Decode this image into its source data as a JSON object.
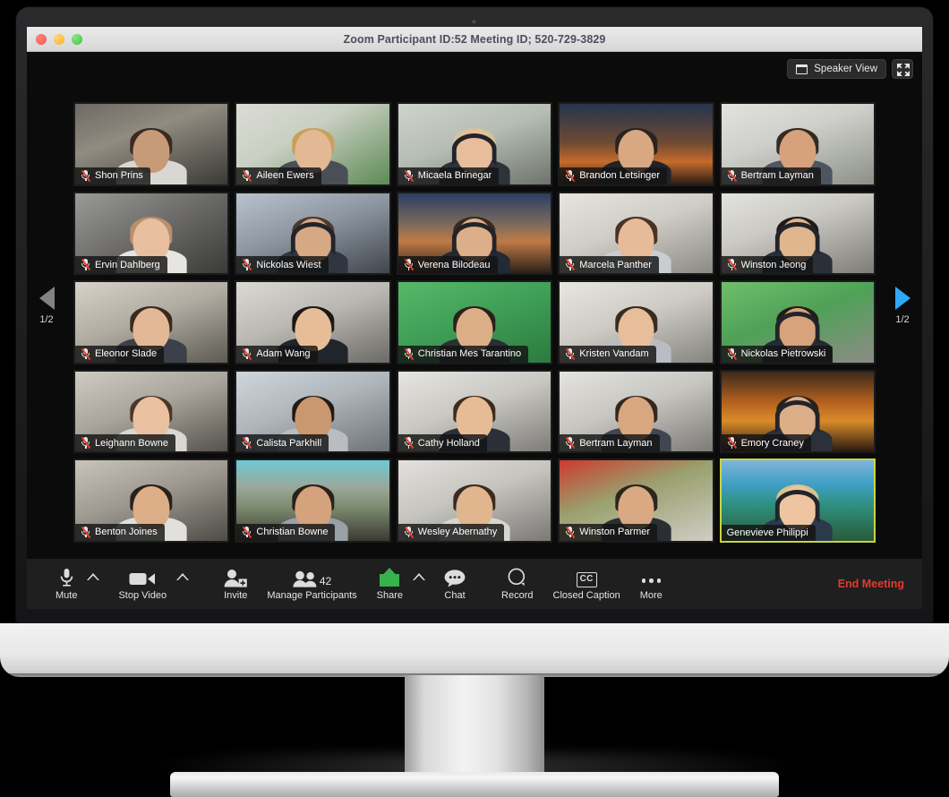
{
  "window": {
    "title": "Zoom Participant ID:52  Meeting ID; 520-729-3829",
    "traffic_lights": [
      "close-red",
      "minimize-yellow",
      "zoom-green"
    ]
  },
  "view_controls": {
    "speaker_view_label": "Speaker View",
    "screen_icon": "screen-icon",
    "fullscreen_icon": "fullscreen-icon"
  },
  "pager": {
    "left_label": "1/2",
    "right_label": "1/2",
    "left_icon": "triangle-left-icon",
    "right_icon": "triangle-right-icon",
    "left_color": "#828284",
    "right_color": "#2fa8f5"
  },
  "gallery": {
    "active_border_color": "#c7d63f",
    "rows": 5,
    "cols": 5,
    "tiles": [
      {
        "name": "Shon Prins",
        "muted": true,
        "active": false,
        "bg": "linear-gradient(160deg,#6d6a64 0%,#918b80 38%,#3b3a38 100%)",
        "skin": "#c79a78",
        "hair": "#3b2a20",
        "shirt": "#d8d7d3",
        "headphones": false
      },
      {
        "name": "Aileen Ewers",
        "muted": true,
        "active": false,
        "bg": "linear-gradient(150deg,#dcdcd6 0%,#c9cfc2 40%,#5d8a55 100%)",
        "skin": "#e3b894",
        "hair": "#c9a05a",
        "shirt": "#4a4f57",
        "headphones": false
      },
      {
        "name": "Micaela Brinegar",
        "muted": true,
        "active": false,
        "bg": "linear-gradient(160deg,#cfd3cd 0%,#b6bdb4 45%,#6e746c 100%)",
        "skin": "#e7bd9c",
        "hair": "#d7c49a",
        "shirt": "#2e3339",
        "headphones": true
      },
      {
        "name": "Brandon Letsinger",
        "muted": true,
        "active": false,
        "bg": "linear-gradient(180deg,#25344f 0%,#6e4a32 48%,#c56a2c 72%,#2a1c14 100%)",
        "skin": "#d8a882",
        "hair": "#2a2420",
        "shirt": "#20232a",
        "headphones": false
      },
      {
        "name": "Bertram Layman",
        "muted": true,
        "active": false,
        "bg": "linear-gradient(160deg,#e2e2de 0%,#cfd0cb 40%,#8d9089 100%)",
        "skin": "#d6a17c",
        "hair": "#342a22",
        "shirt": "#4d5560",
        "headphones": false
      },
      {
        "name": "Ervin Dahlberg",
        "muted": true,
        "active": false,
        "bg": "linear-gradient(150deg,#9a9a97 0%,#6f6e6c 45%,#3a3a39 100%)",
        "skin": "#e8c0a0",
        "hair": "#b8906a",
        "shirt": "#e6e5e1",
        "headphones": false
      },
      {
        "name": "Nickolas Wiest",
        "muted": true,
        "active": false,
        "bg": "linear-gradient(160deg,#b9c3cd 0%,#8d96a0 45%,#41464d 100%)",
        "skin": "#d6a884",
        "hair": "#4a3a2c",
        "shirt": "#2f3640",
        "headphones": true
      },
      {
        "name": "Verena Bilodeau",
        "muted": true,
        "active": false,
        "bg": "linear-gradient(180deg,#2a3e63 0%,#7a6a5c 38%,#c07a46 60%,#2b2018 100%)",
        "skin": "#dcae8a",
        "hair": "#3a2a20",
        "shirt": "#232a33",
        "headphones": true
      },
      {
        "name": "Marcela Panther",
        "muted": true,
        "active": false,
        "bg": "linear-gradient(160deg,#e6e4de 0%,#cfcdc6 45%,#8b8a85 100%)",
        "skin": "#e6bb97",
        "hair": "#4a3325",
        "shirt": "#c9cdd2",
        "headphones": false
      },
      {
        "name": "Winston Jeong",
        "muted": true,
        "active": false,
        "bg": "linear-gradient(160deg,#e4e3df 0%,#cac9c3 40%,#7e7d78 100%)",
        "skin": "#e0b68f",
        "hair": "#201a16",
        "shirt": "#2b3038",
        "headphones": true
      },
      {
        "name": "Eleonor Slade",
        "muted": true,
        "active": false,
        "bg": "linear-gradient(160deg,#d6d2c8 0%,#b0aca2 45%,#5d5a53 100%)",
        "skin": "#e2b896",
        "hair": "#3a2a1e",
        "shirt": "#3c4049",
        "headphones": false
      },
      {
        "name": "Adam Wang",
        "muted": true,
        "active": false,
        "bg": "linear-gradient(160deg,#dbd9d3 0%,#bab8b2 45%,#6b6a66 100%)",
        "skin": "#e6bd96",
        "hair": "#1d1815",
        "shirt": "#20242b",
        "headphones": false
      },
      {
        "name": "Christian Mes Tarantino",
        "muted": true,
        "active": false,
        "bg": "linear-gradient(160deg,#57b86a 0%,#3f9e56 48%,#2c7a40 100%)",
        "skin": "#dcae88",
        "hair": "#2a211a",
        "shirt": "#2a2f36",
        "headphones": false
      },
      {
        "name": "Kristen Vandam",
        "muted": true,
        "active": false,
        "bg": "linear-gradient(160deg,#e8e6e0 0%,#cdcbc4 45%,#86847f 100%)",
        "skin": "#e8bd9a",
        "hair": "#3a2b20",
        "shirt": "#b9bcc2",
        "headphones": false
      },
      {
        "name": "Nickolas Pietrowski",
        "muted": true,
        "active": false,
        "bg": "linear-gradient(160deg,#6fbf6a 0%,#4fa158 45%,#8d8b85 100%)",
        "skin": "#d6a37c",
        "hair": "#241c16",
        "shirt": "#262b32",
        "headphones": true
      },
      {
        "name": "Leighann Bowne",
        "muted": true,
        "active": false,
        "bg": "linear-gradient(160deg,#cfcbc2 0%,#a9a59c 45%,#55524c 100%)",
        "skin": "#e9c0a0",
        "hair": "#4a3527",
        "shirt": "#d9d7d2",
        "headphones": false
      },
      {
        "name": "Calista Parkhill",
        "muted": true,
        "active": false,
        "bg": "linear-gradient(160deg,#cfd6dc 0%,#aeb5bb 45%,#6e7377 100%)",
        "skin": "#c99870",
        "hair": "#241a14",
        "shirt": "#b9bdc2",
        "headphones": false
      },
      {
        "name": "Cathy Holland",
        "muted": true,
        "active": false,
        "bg": "linear-gradient(160deg,#e6e5e1 0%,#c9c8c3 45%,#7e7d79 100%)",
        "skin": "#e6bb96",
        "hair": "#3d2b1e",
        "shirt": "#2b3038",
        "headphones": false
      },
      {
        "name": "Bertram Layman",
        "muted": true,
        "active": false,
        "bg": "linear-gradient(160deg,#e4e3df 0%,#c7c6c1 45%,#7c7b77 100%)",
        "skin": "#d8a77f",
        "hair": "#33271e",
        "shirt": "#3f464f",
        "headphones": false
      },
      {
        "name": "Emory Craney",
        "muted": true,
        "active": false,
        "bg": "linear-gradient(180deg,#3a2a1c 0%,#b4601f 38%,#d98b2a 62%,#2a1a10 100%)",
        "skin": "#dcae87",
        "hair": "#2a211a",
        "shirt": "#2c3139",
        "headphones": true
      },
      {
        "name": "Benton Joines",
        "muted": true,
        "active": false,
        "bg": "linear-gradient(160deg,#c8c4bb 0%,#9d9990 45%,#4e4b46 100%)",
        "skin": "#dcae87",
        "hair": "#2a2019",
        "shirt": "#e2e0dc",
        "headphones": false
      },
      {
        "name": "Christian Bowne",
        "muted": true,
        "active": false,
        "bg": "linear-gradient(180deg,#6ec9d4 0%,#9aa79a 34%,#7d8b6e 58%,#3a3a34 100%)",
        "skin": "#d4a27c",
        "hair": "#2a211a",
        "shirt": "#9aa0a7",
        "headphones": false
      },
      {
        "name": "Wesley Abernathy",
        "muted": true,
        "active": false,
        "bg": "linear-gradient(160deg,#e2e1dd 0%,#c5c4bf 45%,#7a7975 100%)",
        "skin": "#e0b68f",
        "hair": "#3a2b20",
        "shirt": "#d8d6d1",
        "headphones": false
      },
      {
        "name": "Winston Parmer",
        "muted": true,
        "active": false,
        "bg": "linear-gradient(160deg,#cc3b2e 0%,#9aa06e 42%,#cfcdc6 100%)",
        "skin": "#d8a982",
        "hair": "#2e241c",
        "shirt": "#2a2f36",
        "headphones": false
      },
      {
        "name": "Genevieve Philippi",
        "muted": false,
        "active": true,
        "bg": "linear-gradient(180deg,#7fb4dc 0%,#3f9fc4 30%,#2f8f7e 56%,#2a5a3a 100%)",
        "skin": "#eec5a0",
        "hair": "#d9c28e",
        "shirt": "#2b3a4a",
        "headphones": true
      }
    ]
  },
  "controlbar": {
    "items": [
      {
        "id": "mute",
        "label": "Mute",
        "icon": "microphone-icon",
        "caret": true
      },
      {
        "id": "stop-video",
        "label": "Stop Video",
        "icon": "video-camera-icon",
        "caret": true
      },
      {
        "id": "invite",
        "label": "Invite",
        "icon": "person-add-icon",
        "caret": false
      },
      {
        "id": "manage-participants",
        "label": "Manage Participants",
        "icon": "people-icon",
        "caret": false,
        "badge": "42"
      },
      {
        "id": "share",
        "label": "Share",
        "icon": "share-screen-icon",
        "caret": true
      },
      {
        "id": "chat",
        "label": "Chat",
        "icon": "chat-bubble-icon",
        "caret": false
      },
      {
        "id": "record",
        "label": "Record",
        "icon": "record-circle-icon",
        "caret": false
      },
      {
        "id": "closed-caption",
        "label": "Closed Caption",
        "icon": "cc-icon",
        "caret": false,
        "glyph": "CC"
      },
      {
        "id": "more",
        "label": "More",
        "icon": "ellipsis-icon",
        "caret": false
      }
    ],
    "end_meeting_label": "End Meeting",
    "end_meeting_color": "#e5392c",
    "share_icon_color": "#37b24d"
  }
}
